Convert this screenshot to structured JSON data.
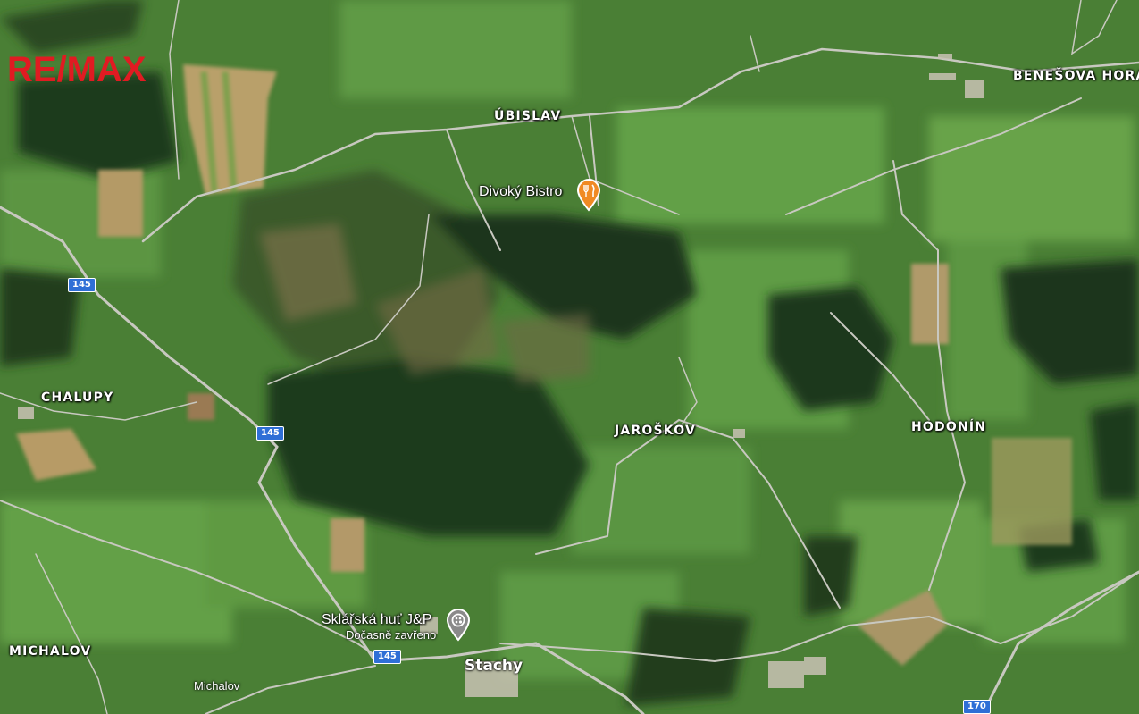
{
  "brand": {
    "logo_text": "RE/MAX",
    "color": "#e11b22"
  },
  "places": {
    "benesova_hora": "BENEŠOVA HORA",
    "ubislav": "ÚBISLAV",
    "chalupy": "CHALUPY",
    "jaroskov": "JAROŠKOV",
    "hodonin": "HODONÍN",
    "michalov": "MICHALOV",
    "stachy": "Stachy"
  },
  "roads": {
    "shield_145_a": "145",
    "shield_145_b": "145",
    "shield_145_c": "145",
    "shield_170": "170",
    "michalov_street": "Michalov"
  },
  "pois": {
    "bistro": {
      "name": "Divoký Bistro",
      "icon": "restaurant-icon",
      "color": "#f08a24"
    },
    "glassworks": {
      "name": "Sklářská huť J&P",
      "status": "Dočasně zavřeno",
      "icon": "glass-art-icon",
      "color": "#8a8a8a"
    }
  },
  "colors": {
    "road_shield": "#2f6fd6",
    "meadow": "#4f8a3a",
    "forest": "#1f3f1f"
  }
}
